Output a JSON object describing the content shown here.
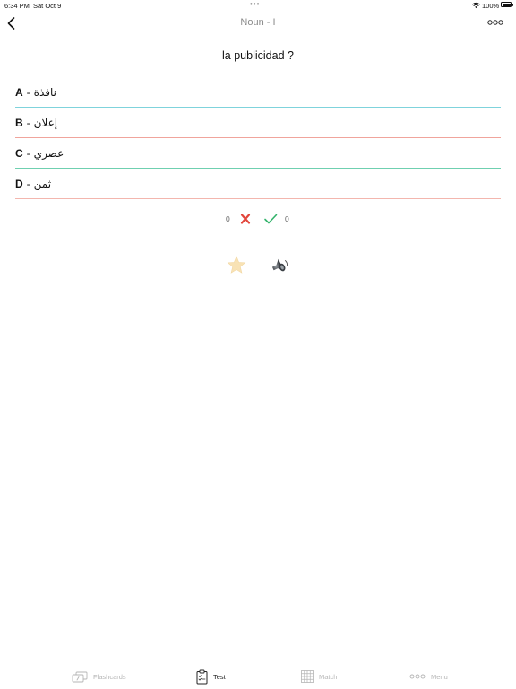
{
  "status_bar": {
    "time": "6:34 PM",
    "date": "Sat Oct 9",
    "battery": "100%"
  },
  "nav": {
    "title": "Noun - I"
  },
  "question": "la publicidad ?",
  "options": [
    {
      "letter": "A",
      "text": "نافذة",
      "color": "#7fd3dc"
    },
    {
      "letter": "B",
      "text": "إعلان",
      "color": "#f0a49c"
    },
    {
      "letter": "C",
      "text": "عصري",
      "color": "#6fd0b0"
    },
    {
      "letter": "D",
      "text": "ثمن",
      "color": "#f3b6ae"
    }
  ],
  "score": {
    "wrong": "0",
    "right": "0",
    "wrong_color": "#e2463c",
    "right_color": "#33b36b"
  },
  "colors": {
    "star": "#f8e2b4",
    "inactive_tab": "#b5b5b5"
  },
  "tabs": [
    {
      "label": "Flashcards",
      "icon": "flashcards-icon",
      "active": false
    },
    {
      "label": "Test",
      "icon": "clipboard-icon",
      "active": true
    },
    {
      "label": "Match",
      "icon": "grid-icon",
      "active": false
    },
    {
      "label": "Menu",
      "icon": "dots-icon",
      "active": false
    }
  ]
}
